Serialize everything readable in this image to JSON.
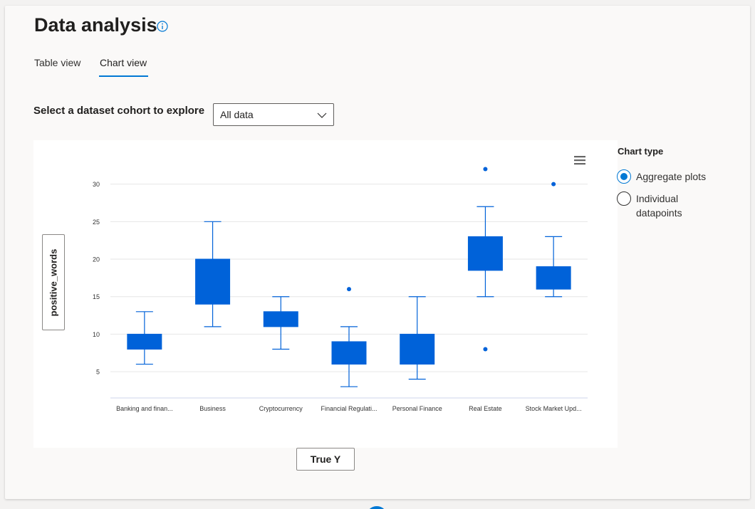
{
  "page": {
    "title": "Data analysis"
  },
  "tabs": [
    {
      "label": "Table view",
      "selected": false
    },
    {
      "label": "Chart view",
      "selected": true
    }
  ],
  "cohort": {
    "label": "Select a dataset cohort to explore",
    "selected": "All data"
  },
  "axes_buttons": {
    "y": "positive_words",
    "x": "True Y"
  },
  "chart_type": {
    "label": "Chart type",
    "options": [
      {
        "label": "Aggregate plots",
        "selected": true
      },
      {
        "label": "Individual datapoints",
        "selected": false
      }
    ]
  },
  "colors": {
    "accent": "#0078d4",
    "box": "#0062d9"
  },
  "icons": [
    "info-icon",
    "chevron-down-icon",
    "hamburger-menu-icon"
  ],
  "chart_data": {
    "type": "boxplot",
    "title": "",
    "xlabel": "True Y",
    "ylabel": "positive_words",
    "ylim": [
      1.5,
      33
    ],
    "yticks": [
      5,
      10,
      15,
      20,
      25,
      30
    ],
    "grid": true,
    "categories": [
      "Banking and finan...",
      "Business",
      "Cryptocurrency",
      "Financial Regulati...",
      "Personal Finance",
      "Real Estate",
      "Stock Market Upd..."
    ],
    "boxes": [
      {
        "min": 6,
        "q1": 8,
        "median": 8,
        "q3": 10,
        "max": 13,
        "outliers": []
      },
      {
        "min": 11,
        "q1": 14,
        "median": 14,
        "q3": 20,
        "max": 25,
        "outliers": []
      },
      {
        "min": 8,
        "q1": 11,
        "median": 11,
        "q3": 13,
        "max": 15,
        "outliers": []
      },
      {
        "min": 3,
        "q1": 6,
        "median": 6,
        "q3": 9,
        "max": 11,
        "outliers": [
          16
        ]
      },
      {
        "min": 4,
        "q1": 6,
        "median": 6,
        "q3": 10,
        "max": 15,
        "outliers": []
      },
      {
        "min": 15,
        "q1": 18.5,
        "median": 18.5,
        "q3": 23,
        "max": 27,
        "outliers": [
          32,
          8
        ]
      },
      {
        "min": 15,
        "q1": 16,
        "median": 16,
        "q3": 19,
        "max": 23,
        "outliers": [
          30
        ]
      }
    ]
  }
}
